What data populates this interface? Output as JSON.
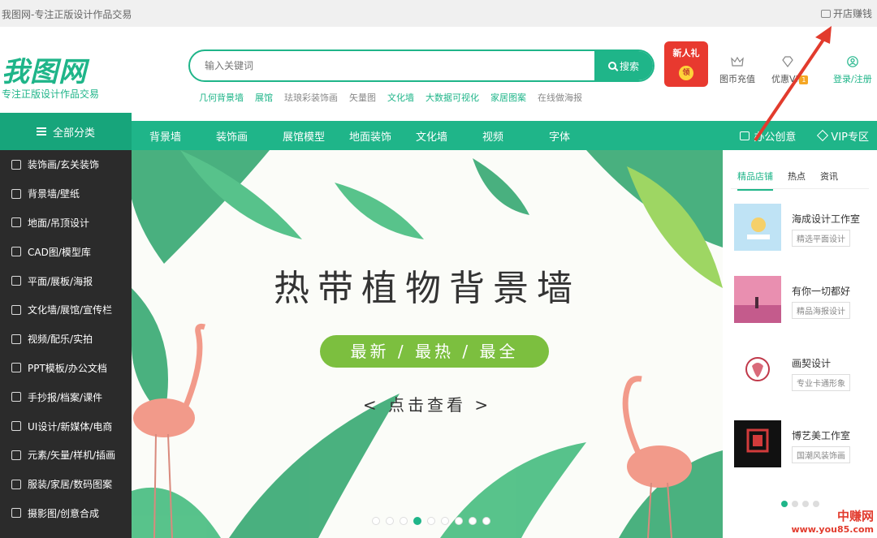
{
  "topbar": {
    "site_title": "我图网-专注正版设计作品交易",
    "open_shop": "开店赚钱"
  },
  "header": {
    "logo": "我图网",
    "logo_sub": "专注正版设计作品交易",
    "search_placeholder": "输入关键词",
    "search_button": "搜索",
    "hotwords": [
      "几何背景墙",
      "展馆",
      "珐琅彩装饰画",
      "矢量图",
      "文化墙",
      "大数据可视化",
      "家居图案",
      "在线做海报"
    ],
    "new_gift": "新人礼",
    "new_gift_coin": "领",
    "recharge": "图币充值",
    "vip": "优惠VIP",
    "vip_badge": "1",
    "login": "登录/注册"
  },
  "nav": {
    "all_categories": "全部分类",
    "items": [
      "背景墙",
      "装饰画",
      "展馆模型",
      "地面装饰",
      "文化墙",
      "视频",
      "字体"
    ],
    "office": "办公创意",
    "vip_zone": "VIP专区"
  },
  "sidebar": [
    "装饰画/玄关装饰",
    "背景墙/壁纸",
    "地面/吊顶设计",
    "CAD图/模型库",
    "平面/展板/海报",
    "文化墙/展馆/宣传栏",
    "视频/配乐/实拍",
    "PPT模板/办公文档",
    "手抄报/档案/课件",
    "UI设计/新媒体/电商",
    "元素/矢量/样机/插画",
    "服装/家居/数码图案",
    "摄影图/创意合成"
  ],
  "banner": {
    "title": "热带植物背景墙",
    "pill": "最新 / 最热 / 最全",
    "cta": "< 点击查看 >",
    "dot_count": 9,
    "active_dot": 3
  },
  "right_panel": {
    "tabs": [
      "精品店铺",
      "热点",
      "资讯"
    ],
    "shops": [
      {
        "name": "海成设计工作室",
        "tag": "精选平面设计"
      },
      {
        "name": "有你一切都好",
        "tag": "精品海报设计"
      },
      {
        "name": "画契设计",
        "tag": "专业卡通形象"
      },
      {
        "name": "博艺美工作室",
        "tag": "国潮风装饰画"
      }
    ]
  },
  "watermark": {
    "line1": "中赚网",
    "line2": "www.you85.com"
  },
  "colors": {
    "accent": "#1fb589",
    "sidebar_bg": "#2b2b2b",
    "pill": "#7cbf3f",
    "alert_red": "#e23b2d"
  }
}
